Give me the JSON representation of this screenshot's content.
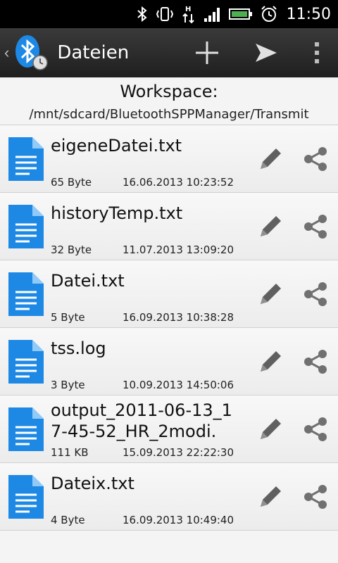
{
  "status": {
    "time": "11:50"
  },
  "actionbar": {
    "title": "Dateien"
  },
  "workspace": {
    "title": "Workspace:",
    "path": "/mnt/sdcard/BluetoothSPPManager/Transmit"
  },
  "files": [
    {
      "name": "eigeneDatei.txt",
      "size": "65 Byte",
      "date": "16.06.2013 10:23:52"
    },
    {
      "name": "historyTemp.txt",
      "size": "32 Byte",
      "date": "11.07.2013 13:09:20"
    },
    {
      "name": "Datei.txt",
      "size": "5 Byte",
      "date": "16.09.2013 10:38:28"
    },
    {
      "name": "tss.log",
      "size": "3 Byte",
      "date": "10.09.2013 14:50:06"
    },
    {
      "name": "output_2011-06-13_17-45-52_HR_2modi.",
      "size": "111 KB",
      "date": "15.09.2013 22:22:30"
    },
    {
      "name": "Dateix.txt",
      "size": "4 Byte",
      "date": "16.09.2013 10:49:40"
    }
  ],
  "colors": {
    "accent": "#1e88e5",
    "actionbar": "#2a2a2a"
  }
}
